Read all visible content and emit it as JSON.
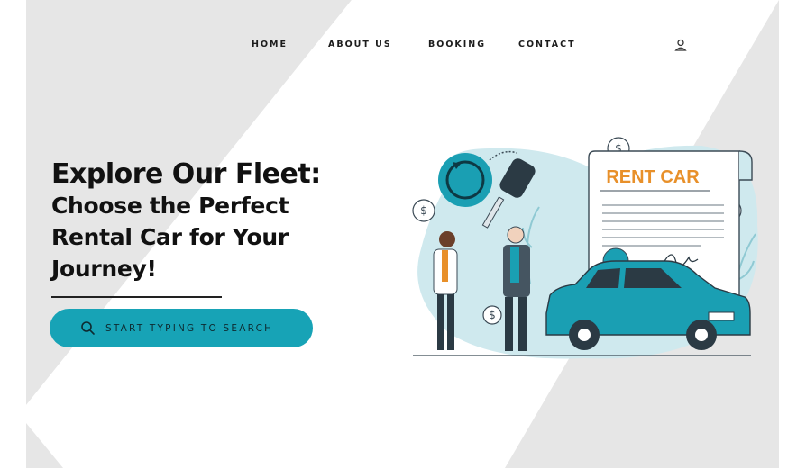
{
  "nav": {
    "items": [
      {
        "label": "HOME"
      },
      {
        "label": "ABOUT US"
      },
      {
        "label": "BOOKING"
      },
      {
        "label": "CONTACT"
      }
    ]
  },
  "hero": {
    "title_line1": "Explore Our Fleet:",
    "title_line2": "Choose the Perfect",
    "title_line3": "Rental Car for Your",
    "title_line4": "Journey!"
  },
  "search": {
    "placeholder": "START TYPING TO SEARCH"
  },
  "illustration": {
    "contract_heading": "RENT CAR"
  },
  "colors": {
    "accent": "#17a3b6",
    "background_stripe": "#e6e6e6",
    "contract_heading": "#e8902a"
  },
  "icons": {
    "user": "user-icon",
    "search": "search-icon"
  }
}
